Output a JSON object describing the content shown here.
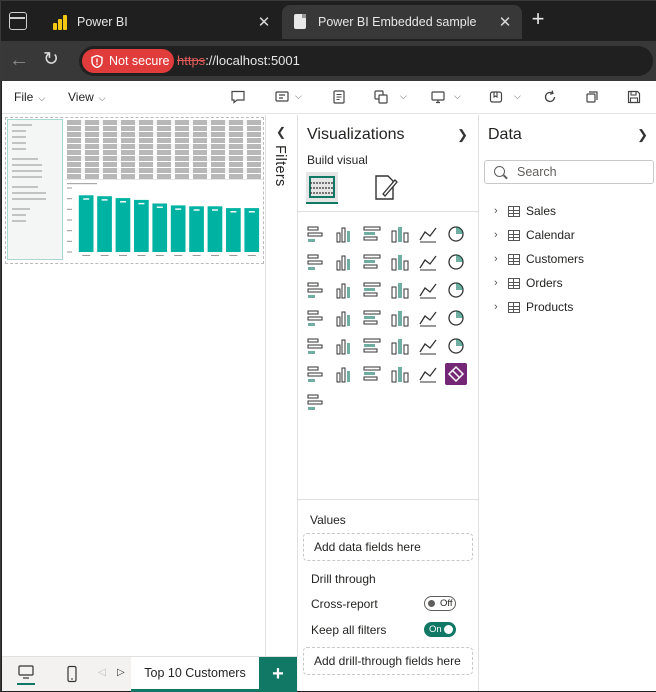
{
  "browser": {
    "tabs": [
      {
        "label": "Power BI",
        "icon": "power-bi-logo"
      },
      {
        "label": "Power BI Embedded sample",
        "icon": "page-icon"
      }
    ],
    "security_label": "Not secure",
    "url_protocol": "https",
    "url_rest": "://localhost:5001"
  },
  "toolbar": {
    "file_label": "File",
    "view_label": "View"
  },
  "filters": {
    "title": "Filters"
  },
  "visualizations": {
    "title": "Visualizations",
    "build_label": "Build visual",
    "values_label": "Values",
    "values_placeholder": "Add data fields here",
    "drill_label": "Drill through",
    "cross_report_label": "Cross-report",
    "cross_report_state": "Off",
    "keep_filters_label": "Keep all filters",
    "keep_filters_state": "On",
    "drill_placeholder": "Add drill-through fields here",
    "accent_color": "#117865"
  },
  "data_pane": {
    "title": "Data",
    "search_placeholder": "Search",
    "tables": [
      "Sales",
      "Calendar",
      "Customers",
      "Orders",
      "Products"
    ]
  },
  "pages": {
    "active_tab": "Top 10 Customers"
  },
  "chart_data": {
    "type": "bar",
    "bar_color": "#00b2a2",
    "values": [
      62,
      61,
      59,
      57,
      53,
      51,
      50,
      50,
      48,
      48
    ]
  }
}
